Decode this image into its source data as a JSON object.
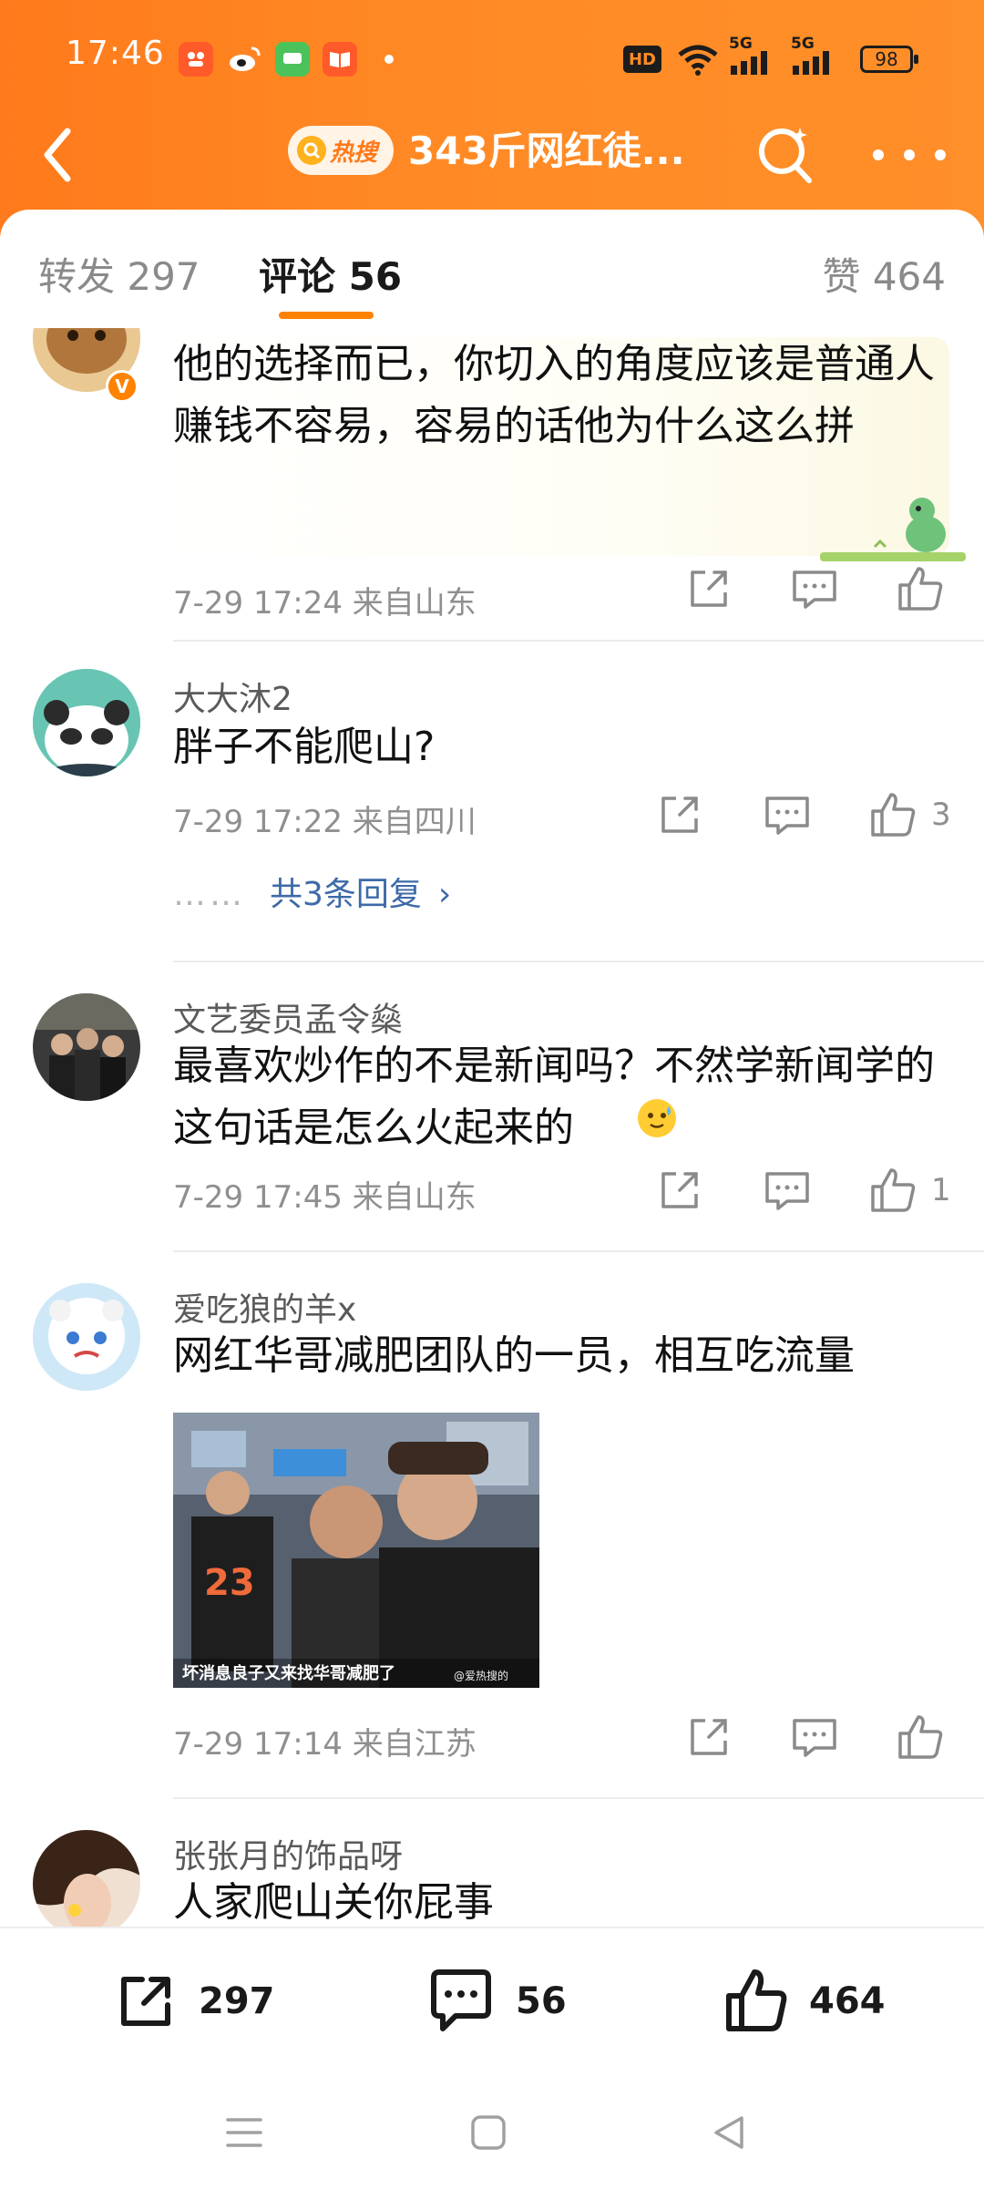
{
  "status_bar": {
    "time": "17:46",
    "hd": "HD",
    "net1": "5G",
    "net2": "5G",
    "battery": "98"
  },
  "header": {
    "hot_badge": "热搜",
    "title": "343斤网红徒..."
  },
  "tabs": {
    "repost": "转发 297",
    "comment": "评论 56",
    "like": "赞 464"
  },
  "comments": [
    {
      "user": "",
      "text": "他的选择而已，你切入的角度应该是普通人赚钱不容易，容易的话他为什么这么拼",
      "meta": "7-29 17:24  来自山东",
      "likes": ""
    },
    {
      "user": "大大沐2",
      "text": "胖子不能爬山?",
      "meta": "7-29 17:22  来自四川",
      "likes": "3",
      "replies": "共3条回复",
      "replies_dots": "……"
    },
    {
      "user": "文艺委员孟令燊",
      "text": "最喜欢炒作的不是新闻吗？不然学新闻学的这句话是怎么火起来的",
      "meta": "7-29 17:45  来自山东",
      "likes": "1"
    },
    {
      "user": "爱吃狼的羊x",
      "text": "网红华哥减肥团队的一员，相互吃流量",
      "meta": "7-29 17:14  来自江苏",
      "likes": "",
      "image_caption": "坏消息良子又来找华哥减肥了",
      "image_watermark": "@爱热搜的",
      "image_jersey": "23"
    },
    {
      "user": "张张月的饰品呀",
      "text": "人家爬山关你屁事"
    }
  ],
  "bottom_bar": {
    "repost_count": "297",
    "comment_count": "56",
    "like_count": "464"
  },
  "colors": {
    "accent": "#ff8200",
    "header_orange": "#ff8a25",
    "link_blue": "#3d6aa8"
  }
}
